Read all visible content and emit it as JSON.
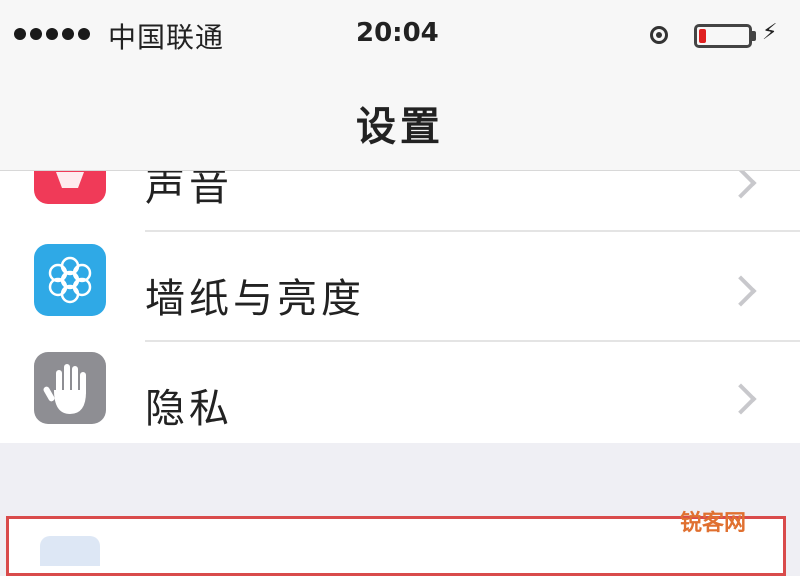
{
  "status_bar": {
    "carrier": "中国联通",
    "time": "20:04",
    "battery_level": 0.15,
    "battery_color": "#e02020"
  },
  "nav": {
    "title": "设置"
  },
  "settings_rows": [
    {
      "label": "声音",
      "icon": "sound-icon",
      "icon_color": "#f03a58"
    },
    {
      "label": "墙纸与亮度",
      "icon": "wallpaper-icon",
      "icon_color": "#2fa9e6"
    },
    {
      "label": "隐私",
      "icon": "hand-icon",
      "icon_color": "#8e8e93"
    }
  ],
  "highlight_color": "#d94b4b",
  "watermark": "锐客网"
}
